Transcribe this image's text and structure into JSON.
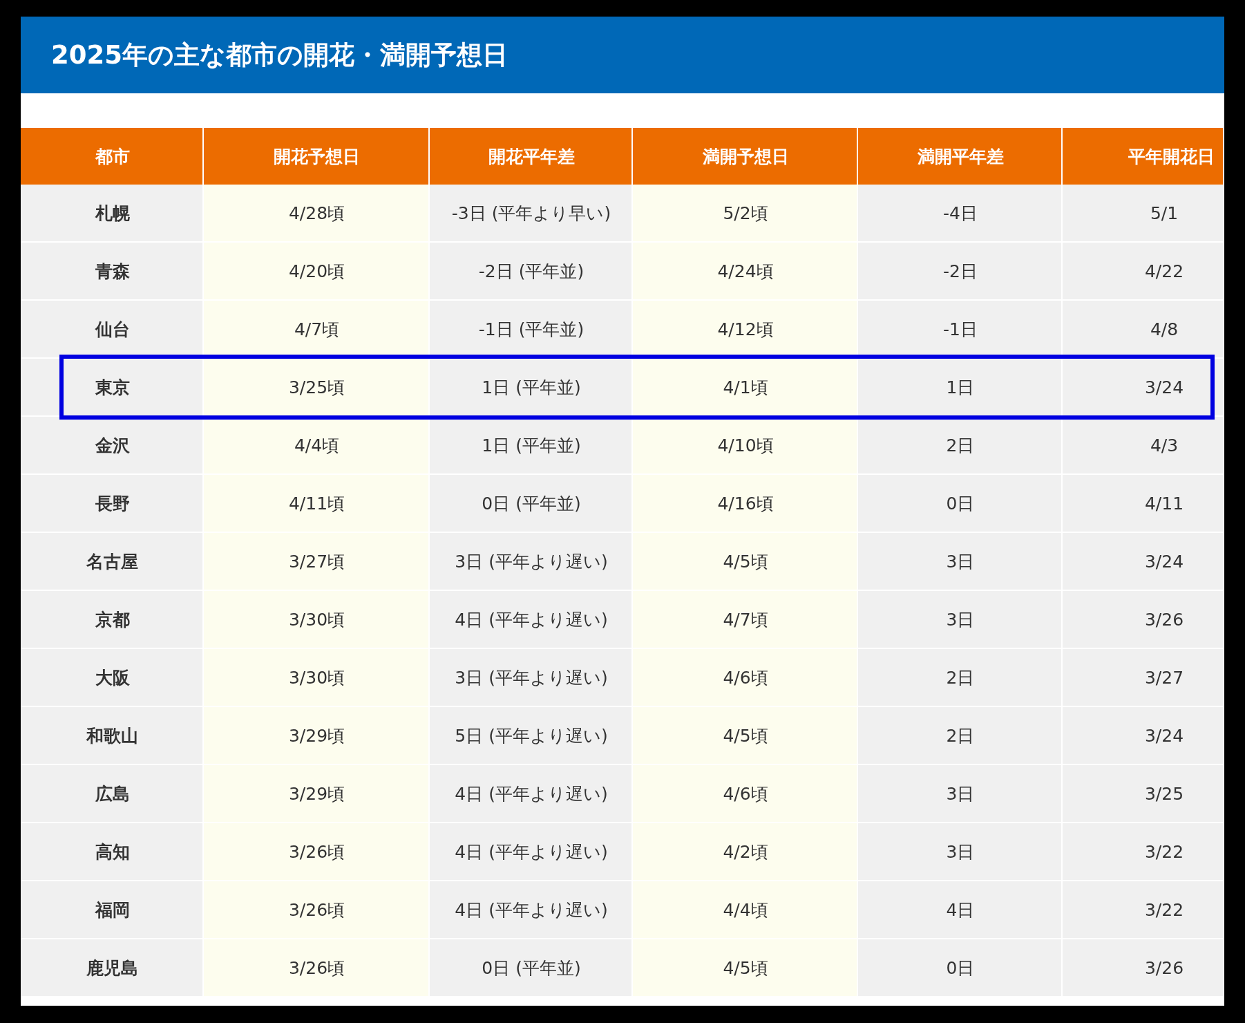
{
  "title": "2025年の主な都市の開花・満開予想日",
  "table": {
    "columns": [
      "都市",
      "開花予想日",
      "開花平年差",
      "満開予想日",
      "満開平年差",
      "平年開花日"
    ],
    "rows": [
      {
        "cells": [
          "札幌",
          "4/28頃",
          "-3日 (平年より早い)",
          "5/2頃",
          "-4日",
          "5/1"
        ],
        "highlighted": false
      },
      {
        "cells": [
          "青森",
          "4/20頃",
          "-2日 (平年並)",
          "4/24頃",
          "-2日",
          "4/22"
        ],
        "highlighted": false
      },
      {
        "cells": [
          "仙台",
          "4/7頃",
          "-1日 (平年並)",
          "4/12頃",
          "-1日",
          "4/8"
        ],
        "highlighted": false
      },
      {
        "cells": [
          "東京",
          "3/25頃",
          "1日 (平年並)",
          "4/1頃",
          "1日",
          "3/24"
        ],
        "highlighted": true
      },
      {
        "cells": [
          "金沢",
          "4/4頃",
          "1日 (平年並)",
          "4/10頃",
          "2日",
          "4/3"
        ],
        "highlighted": false
      },
      {
        "cells": [
          "長野",
          "4/11頃",
          "0日 (平年並)",
          "4/16頃",
          "0日",
          "4/11"
        ],
        "highlighted": false
      },
      {
        "cells": [
          "名古屋",
          "3/27頃",
          "3日 (平年より遅い)",
          "4/5頃",
          "3日",
          "3/24"
        ],
        "highlighted": false
      },
      {
        "cells": [
          "京都",
          "3/30頃",
          "4日 (平年より遅い)",
          "4/7頃",
          "3日",
          "3/26"
        ],
        "highlighted": false
      },
      {
        "cells": [
          "大阪",
          "3/30頃",
          "3日 (平年より遅い)",
          "4/6頃",
          "2日",
          "3/27"
        ],
        "highlighted": false
      },
      {
        "cells": [
          "和歌山",
          "3/29頃",
          "5日 (平年より遅い)",
          "4/5頃",
          "2日",
          "3/24"
        ],
        "highlighted": false
      },
      {
        "cells": [
          "広島",
          "3/29頃",
          "4日 (平年より遅い)",
          "4/6頃",
          "3日",
          "3/25"
        ],
        "highlighted": false
      },
      {
        "cells": [
          "高知",
          "3/26頃",
          "4日 (平年より遅い)",
          "4/2頃",
          "3日",
          "3/22"
        ],
        "highlighted": false
      },
      {
        "cells": [
          "福岡",
          "3/26頃",
          "4日 (平年より遅い)",
          "4/4頃",
          "4日",
          "3/22"
        ],
        "highlighted": false
      },
      {
        "cells": [
          "鹿児島",
          "3/26頃",
          "0日 (平年並)",
          "4/5頃",
          "0日",
          "3/26"
        ],
        "highlighted": false
      }
    ]
  }
}
